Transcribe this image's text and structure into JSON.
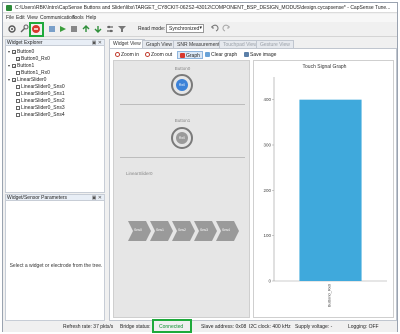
{
  "window": {
    "title": "C:\\Users\\RBK\\Intro\\CapSense Buttons and Slider\\libs\\TARGET_CY8CKIT-062S2-43012\\COMPONENT_BSP_DESIGN_MODUS\\design.cycapsense* - CapSense Tune..."
  },
  "menu": {
    "file": "File",
    "edit": "Edit",
    "view": "View",
    "communication": "Communication",
    "tools": "Tools",
    "help": "Help"
  },
  "toolbar": {
    "read_mode_label": "Read mode:",
    "read_mode_value": "Synchronized",
    "accent": "#1faa3c"
  },
  "widget_explorer": {
    "title": "Widget Explorer",
    "items": [
      {
        "label": "Button0",
        "level": 0,
        "checked": true
      },
      {
        "label": "Button0_Rx0",
        "level": 1,
        "checked": true
      },
      {
        "label": "Button1",
        "level": 0,
        "checked": true
      },
      {
        "label": "Button1_Rx0",
        "level": 1,
        "checked": false
      },
      {
        "label": "LinearSlider0",
        "level": 0,
        "checked": true
      },
      {
        "label": "LinearSlider0_Sns0",
        "level": 1,
        "checked": false
      },
      {
        "label": "LinearSlider0_Sns1",
        "level": 1,
        "checked": false
      },
      {
        "label": "LinearSlider0_Sns2",
        "level": 1,
        "checked": false
      },
      {
        "label": "LinearSlider0_Sns3",
        "level": 1,
        "checked": false
      },
      {
        "label": "LinearSlider0_Sns4",
        "level": 1,
        "checked": false
      }
    ]
  },
  "params": {
    "title": "Widget/Sensor Parameters",
    "message": "Select a widget or electrode from the tree."
  },
  "tabs": [
    {
      "label": "Widget View",
      "state": "active"
    },
    {
      "label": "Graph View",
      "state": "normal"
    },
    {
      "label": "SNR Measurement",
      "state": "normal"
    },
    {
      "label": "Touchpad View",
      "state": "disabled"
    },
    {
      "label": "Gesture View",
      "state": "disabled"
    }
  ],
  "subtools": {
    "zoom_in": "Zoom in",
    "zoom_out": "Zoom out",
    "graph": "Graph",
    "clear_graph": "Clear graph",
    "save_image": "Save image"
  },
  "widgets": {
    "button0": {
      "title": "Button0",
      "state": "Rx0"
    },
    "button1": {
      "title": "Button1",
      "state": "Rx0"
    },
    "slider": {
      "title": "LinearSlider0",
      "segments": [
        "Sns0",
        "Sns1",
        "Sns2",
        "Sns3",
        "Sns4"
      ]
    }
  },
  "graph": {
    "title": "Touch Signal Graph",
    "chart_data": {
      "type": "bar",
      "title": "Touch Signal Graph",
      "categories": [
        "Button0_Rx0"
      ],
      "values": [
        400
      ],
      "ylim": [
        0,
        450
      ],
      "yticks": [
        0,
        100,
        200,
        300,
        400
      ],
      "bar_color": "#3fa9dc"
    }
  },
  "status": {
    "refresh_rate": "Refresh rate:  37 pkts/s",
    "bridge_status_label": "Bridge status:",
    "bridge_status_value": "Connected",
    "slave_address": "Slave address:  0x08",
    "i2c_clock": "I2C clock:  400 kHz",
    "supply_voltage": "Supply voltage:  -",
    "logging": "Logging:  OFF"
  }
}
